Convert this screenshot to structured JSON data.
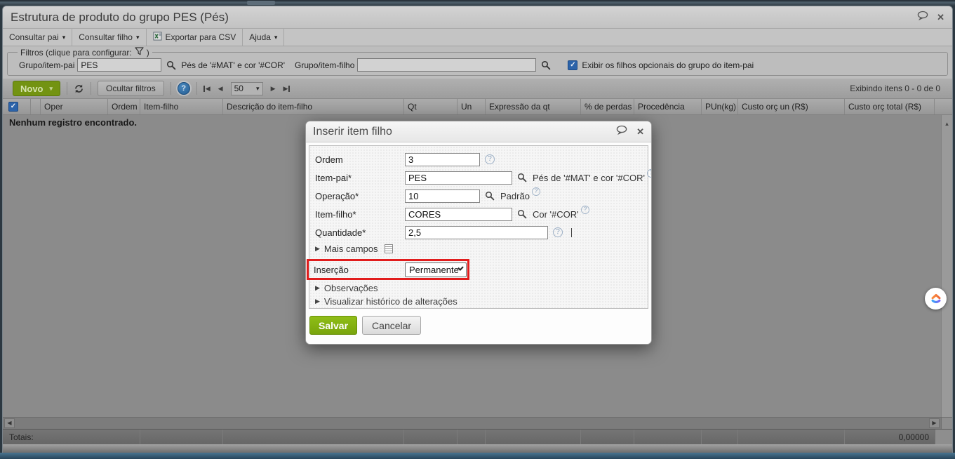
{
  "icons": {
    "caret_down": "▾",
    "check": "✓",
    "close": "✕",
    "help": "?",
    "disclosure": "▶",
    "arrow_left": "◀",
    "arrow_right": "▶",
    "arrow_up": "▴",
    "text_cursor": ""
  },
  "titlebar": {
    "title": "Estrutura de produto do grupo PES (Pés)"
  },
  "menubar": {
    "consultar_pai": "Consultar pai",
    "consultar_filho": "Consultar filho",
    "exportar_csv": "Exportar para CSV",
    "ajuda": "Ajuda"
  },
  "filters": {
    "legend_prefix": "Filtros (clique para configurar:",
    "legend_suffix": ")",
    "grupo_item_pai": {
      "label": "Grupo/item-pai",
      "value": "PES",
      "hint": "Pés de '#MAT' e cor '#COR'"
    },
    "grupo_item_filho": {
      "label": "Grupo/item-filho",
      "value": ""
    },
    "exibir_opcionais": {
      "label": "Exibir os filhos opcionais do grupo do item-pai",
      "checked": true
    }
  },
  "toolbar": {
    "novo": "Novo",
    "ocultar_filtros": "Ocultar filtros",
    "page_size": "50",
    "items_info": "Exibindo itens 0 - 0 de 0"
  },
  "grid": {
    "columns": [
      "Oper",
      "Ordem",
      "Item-filho",
      "Descrição do item-filho",
      "Qt",
      "Un",
      "Expressão da qt",
      "% de perdas",
      "Procedência",
      "PUn(kg)",
      "Custo orç un (R$)",
      "Custo orç total (R$)"
    ],
    "empty_message": "Nenhum registro encontrado.",
    "totals_label": "Totais:",
    "totals_value": "0,00000"
  },
  "dialog": {
    "title": "Inserir item filho",
    "ordem": {
      "label": "Ordem",
      "value": "3"
    },
    "item_pai": {
      "label": "Item-pai*",
      "value": "PES",
      "hint": "Pés de '#MAT' e cor '#COR'"
    },
    "operacao": {
      "label": "Operação*",
      "value": "10",
      "hint": "Padrão"
    },
    "item_filho": {
      "label": "Item-filho*",
      "value": "CORES",
      "hint": "Cor '#COR'"
    },
    "quantidade": {
      "label": "Quantidade*",
      "value": "2,5"
    },
    "mais_campos": "Mais campos",
    "insercao": {
      "label": "Inserção",
      "value": "Permanente"
    },
    "observacoes": "Observações",
    "historico": "Visualizar histórico de alterações",
    "salvar": "Salvar",
    "cancelar": "Cancelar"
  },
  "colors": {
    "novo_green": "#739312",
    "salvar_green": "#84b40f",
    "highlight_red": "#e11d1d",
    "checkbox_blue": "#2c63a9",
    "help_blue": "#2f6fa8"
  }
}
